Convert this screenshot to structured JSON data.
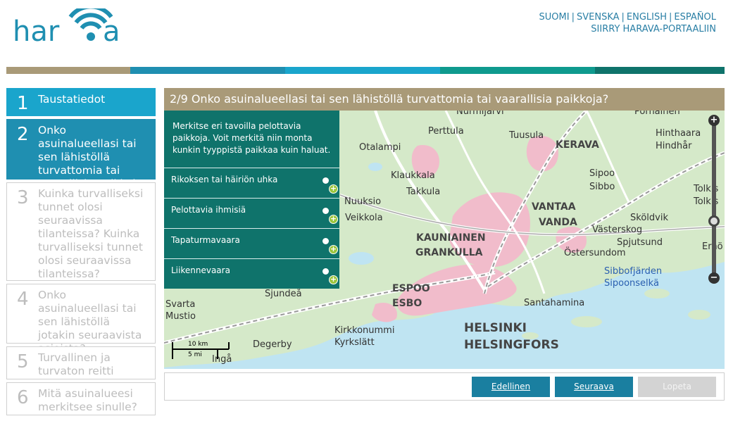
{
  "app": {
    "logo_text": "harava",
    "colors": {
      "brand": "#1f8fb1",
      "accent_green": "#0f736b",
      "header_tan": "#a99a78"
    }
  },
  "header": {
    "languages": [
      "SUOMI",
      "SVENSKA",
      "ENGLISH",
      "ESPAÑOL"
    ],
    "portal_link": "SIIRRY HARAVA-PORTAALIIN"
  },
  "steps": [
    {
      "num": "1",
      "label": "Taustatiedot",
      "state": "done"
    },
    {
      "num": "2",
      "label": "Onko asuinalueellasi tai sen lähistöllä turvattomia tai vaarallisia paikkoja?",
      "state": "active"
    },
    {
      "num": "3",
      "label": "Kuinka turvalliseksi tunnet olosi seuraavissa tilanteissa? Kuinka turvalliseksi tunnet olosi seuraavissa tilanteissa?",
      "state": "disabled"
    },
    {
      "num": "4",
      "label": "Onko asuinalueellasi tai sen lähistöllä jotakin seuraavista asioista?",
      "state": "disabled"
    },
    {
      "num": "5",
      "label": "Turvallinen ja turvaton reitti",
      "state": "disabled"
    },
    {
      "num": "6",
      "label": "Mitä asuinalueesi merkitsee sinulle?",
      "state": "disabled"
    }
  ],
  "question": {
    "title": "2/9 Onko asuinalueellasi tai sen lähistöllä turvattomia tai vaarallisia paikkoja?"
  },
  "panel": {
    "instruction": "Merkitse eri tavoilla pelottavia paikkoja. Voit merkitä niin monta kunkin tyyppistä paikkaa kuin haluat.",
    "categories": [
      "Rikoksen tai häiriön uhka",
      "Pelottavia ihmisiä",
      "Tapaturmavaara",
      "Liikennevaara"
    ]
  },
  "map": {
    "places": {
      "nurmijarvi": "Nurmijärvi",
      "perttula": "Perttula",
      "tuusula": "Tuusula",
      "kerava": "KERAVA",
      "pornainen": "Pornainen",
      "hinthaara": "Hinthaara",
      "hindhar": "Hindhår",
      "otalampi": "Otalampi",
      "klaukkala": "Klaukkala",
      "takkula": "Takkula",
      "sipoo": "Sipoo",
      "sibbo": "Sibbo",
      "tolkis1": "Tolkis",
      "tolkis2": "Tolkis",
      "vantaa": "VANTAA",
      "vanda": "VANDA",
      "skoldvik": "Sköldvik",
      "nuuksio": "Nuuksio",
      "veikkola": "Veikkola",
      "kauniainen": "KAUNIAINEN",
      "grankulla": "GRANKULLA",
      "vasterskog": "Västerskog",
      "spjutsund": "Spjutsund",
      "ostersundom": "Östersundom",
      "erno": "Ernö",
      "sibbofjarden": "Sibbofjärden",
      "sipoonselka": "Sipoonselkä",
      "espoo": "ESPOO",
      "esbo": "ESBO",
      "sjundea": "Sjundeå",
      "svarta": "Svarta",
      "mustio": "Mustio",
      "santahamina": "Santahamina",
      "kirkkonummi": "Kirkkonummi",
      "kyrkslatt": "Kyrkslätt",
      "helsinki": "HELSINKI",
      "helsingfors": "HELSINGFORS",
      "degerby": "Degerby",
      "inga": "Ingå"
    },
    "scale_km": "10 km",
    "scale_mi": "5 mi"
  },
  "nav": {
    "prev": "Edellinen",
    "next": "Seuraava",
    "finish": "Lopeta"
  }
}
